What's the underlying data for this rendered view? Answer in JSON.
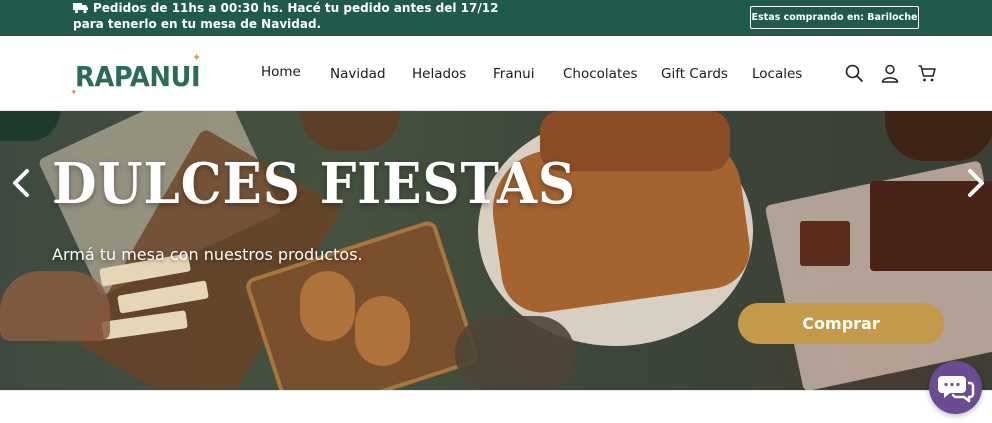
{
  "topbar": {
    "message": "Pedidos de 11hs a 00:30 hs. Hacé tu pedido antes del 17/12 para tenerlo en tu mesa de Navidad.",
    "store_button": "Estas comprando en: Bariloche",
    "background": "#1f5a4d"
  },
  "header": {
    "logo_text": "RAPANUI",
    "logo_color": "#2a6b5a",
    "nav": [
      {
        "label": "Home"
      },
      {
        "label": "Navidad"
      },
      {
        "label": "Helados"
      },
      {
        "label": "Franui"
      },
      {
        "label": "Chocolates"
      },
      {
        "label": "Gift Cards"
      },
      {
        "label": "Locales"
      }
    ],
    "icons": [
      "search-icon",
      "user-icon",
      "cart-icon"
    ]
  },
  "hero": {
    "title": "DULCES FIESTAS",
    "subtitle": "Armá tu mesa con nuestros productos.",
    "cta": "Comprar",
    "cta_color": "#c49a4a",
    "prev_icon": "chevron-left-icon",
    "next_icon": "chevron-right-icon"
  },
  "chat": {
    "icon": "chat-bubbles-icon",
    "color": "#6a4c93"
  }
}
